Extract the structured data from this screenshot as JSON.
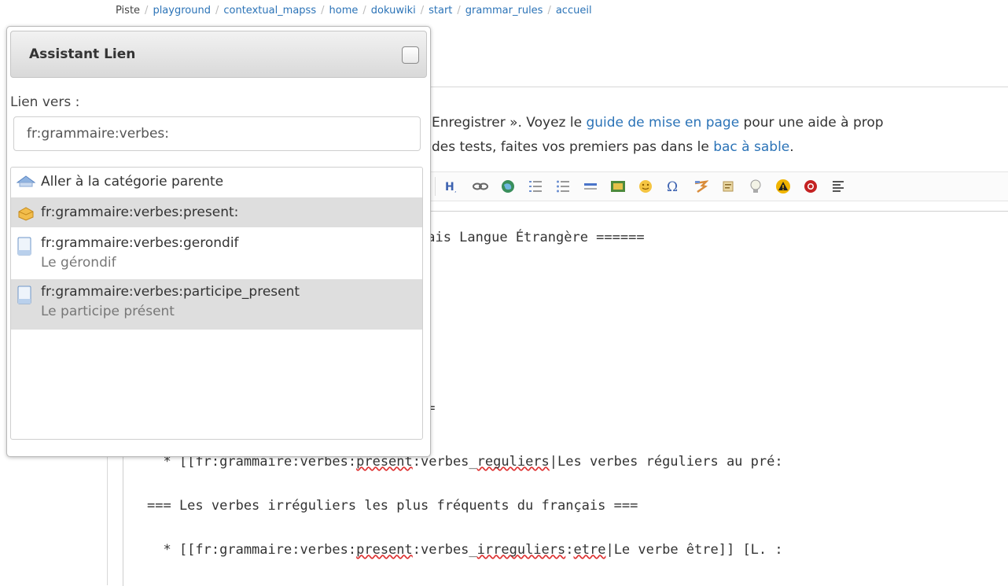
{
  "breadcrumb": {
    "items": [
      "Piste",
      "playground",
      "contextual_mapss",
      "home",
      "dokuwiki",
      "start",
      "grammar_rules",
      "accueil"
    ]
  },
  "intro": {
    "line1_a": "Enregistrer ». Voyez le ",
    "line1_link": "guide de mise en page",
    "line1_b": " pour une aide à prop",
    "line2_a": "des tests, faites vos premiers pas dans le ",
    "line2_link": "bac à sable",
    "line2_b": "."
  },
  "toolbar": {
    "buttons": [
      "heading",
      "link",
      "external-link",
      "ordered-list",
      "unordered-list",
      "horizontal-rule",
      "image",
      "smiley",
      "special-chars",
      "signature",
      "note",
      "tip",
      "warning",
      "important",
      "align"
    ]
  },
  "editor": {
    "line1": "çais Langue Étrangère ======",
    "line2": "==",
    "line3_prefix": "  * [[fr:grammaire:verbes:",
    "line3_sq1": "present",
    "line3_mid": ":verbes_",
    "line3_sq2": "reguliers",
    "line3_rest": "|Les verbes réguliers au pré:",
    "line4": "=== Les verbes irréguliers les plus fréquents du français ===",
    "line5_prefix": "  * [[fr:grammaire:verbes:",
    "line5_sq1": "present",
    "line5_mid": ":verbes_",
    "line5_sq2": "irreguliers",
    "line5_sep": ":",
    "line5_sq3": "etre",
    "line5_rest": "|Le verbe être]] [L. :"
  },
  "dialog": {
    "title": "Assistant Lien",
    "link_label": "Lien vers :",
    "link_value": "fr:grammaire:verbes:",
    "results": [
      {
        "text": "Aller à la catégorie parente",
        "sub": "",
        "icon": "up-arrow-icon",
        "selected": false
      },
      {
        "text": "fr:grammaire:verbes:present:",
        "sub": "",
        "icon": "folder-icon",
        "selected": true
      },
      {
        "text": "fr:grammaire:verbes:gerondif",
        "sub": "Le gérondif",
        "icon": "page-icon",
        "selected": false
      },
      {
        "text": "fr:grammaire:verbes:participe_present",
        "sub": "Le participe présent",
        "icon": "page-icon",
        "selected": true
      }
    ]
  },
  "colors": {
    "link": "#2b73b7",
    "selected_row": "#dedede"
  }
}
